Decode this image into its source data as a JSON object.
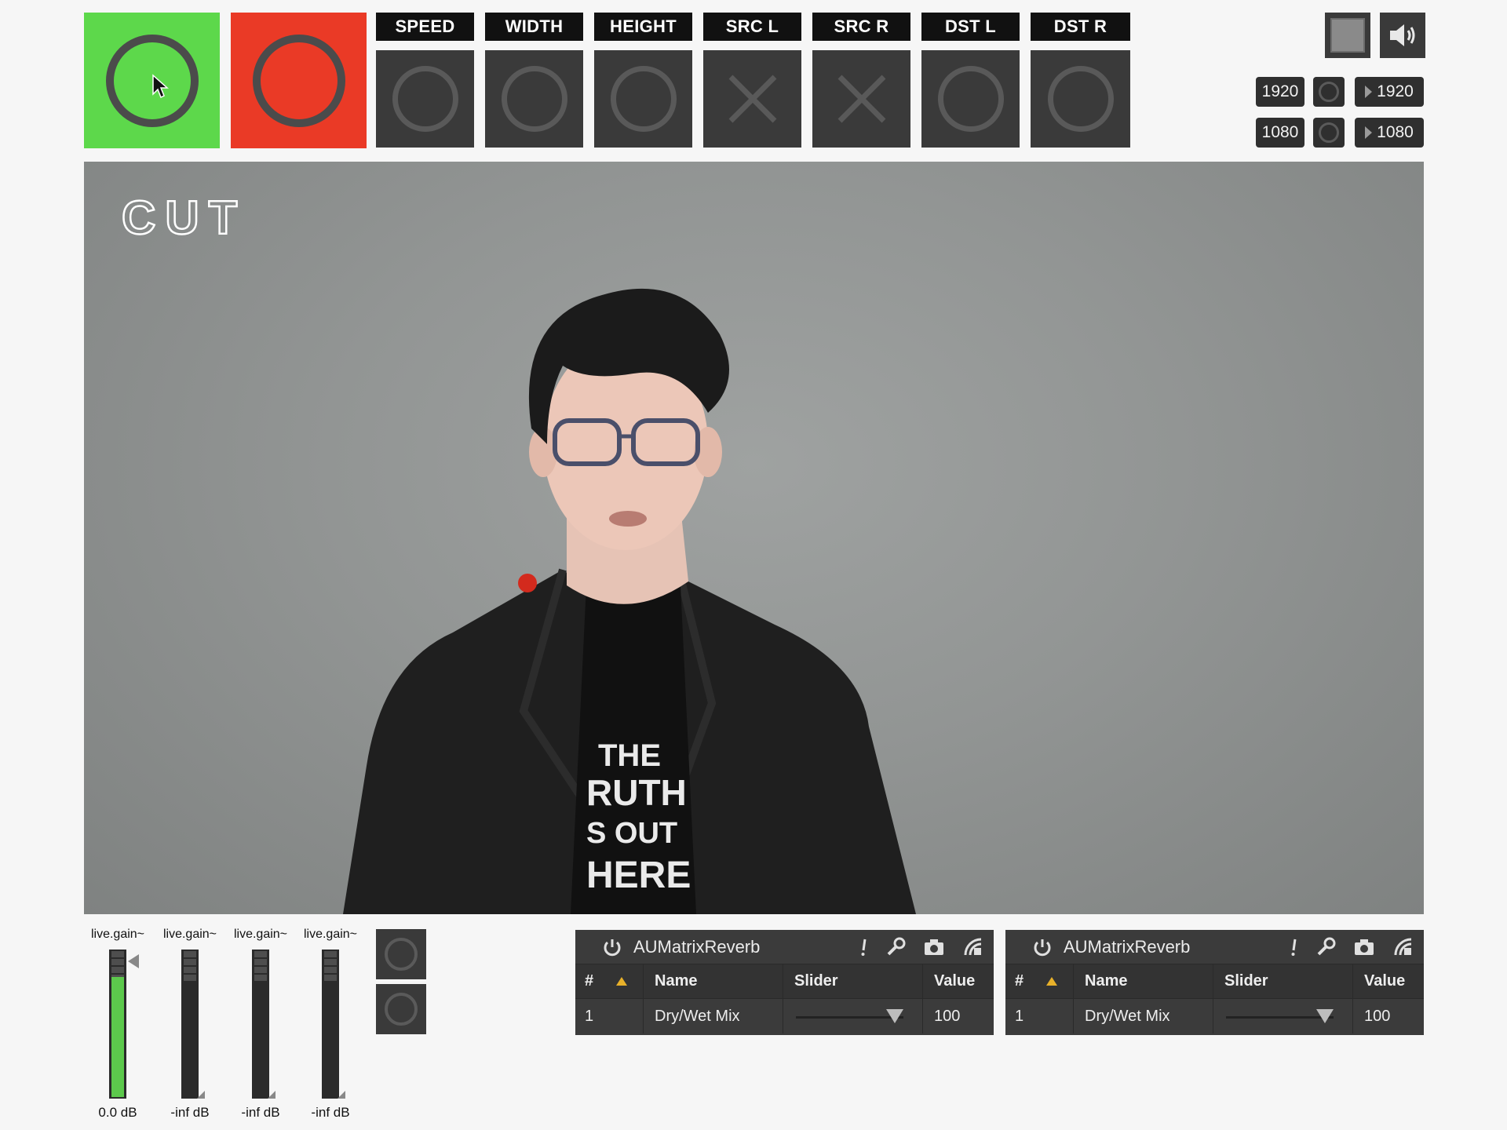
{
  "top_toggles": [
    {
      "id": "on",
      "color": "#5dd84b"
    },
    {
      "id": "record",
      "color": "#ea3a26"
    }
  ],
  "columns": [
    {
      "label": "SPEED",
      "symbol": "circle"
    },
    {
      "label": "WIDTH",
      "symbol": "circle"
    },
    {
      "label": "HEIGHT",
      "symbol": "circle"
    },
    {
      "label": "SRC L",
      "symbol": "x"
    },
    {
      "label": "SRC R",
      "symbol": "x"
    },
    {
      "label": "DST L",
      "symbol": "circle"
    },
    {
      "label": "DST R",
      "symbol": "circle"
    }
  ],
  "dims": {
    "width_in": "1920",
    "width_out": "1920",
    "height_in": "1080",
    "height_out": "1080"
  },
  "video": {
    "overlay_text": "CUT",
    "shirt_text": [
      "THE",
      "RUTH",
      "S OUT",
      "HERE"
    ]
  },
  "meters": [
    {
      "name": "live.gain~",
      "value": "0.0 dB",
      "level": 0.82
    },
    {
      "name": "live.gain~",
      "value": "-inf dB",
      "level": 0
    },
    {
      "name": "live.gain~",
      "value": "-inf dB",
      "level": 0
    },
    {
      "name": "live.gain~",
      "value": "-inf dB",
      "level": 0
    }
  ],
  "plugins": [
    {
      "name": "AUMatrixReverb",
      "headers": {
        "num": "#",
        "name": "Name",
        "slider": "Slider",
        "value": "Value"
      },
      "row": {
        "num": "1",
        "name": "Dry/Wet Mix",
        "value": "100",
        "slider_fraction": 1.0
      }
    },
    {
      "name": "AUMatrixReverb",
      "headers": {
        "num": "#",
        "name": "Name",
        "slider": "Slider",
        "value": "Value"
      },
      "row": {
        "num": "1",
        "name": "Dry/Wet Mix",
        "value": "100",
        "slider_fraction": 1.0
      }
    }
  ],
  "icons": [
    "speaker-icon",
    "power-icon",
    "exclamation-icon",
    "wrench-icon",
    "camera-icon",
    "preset-icon"
  ]
}
